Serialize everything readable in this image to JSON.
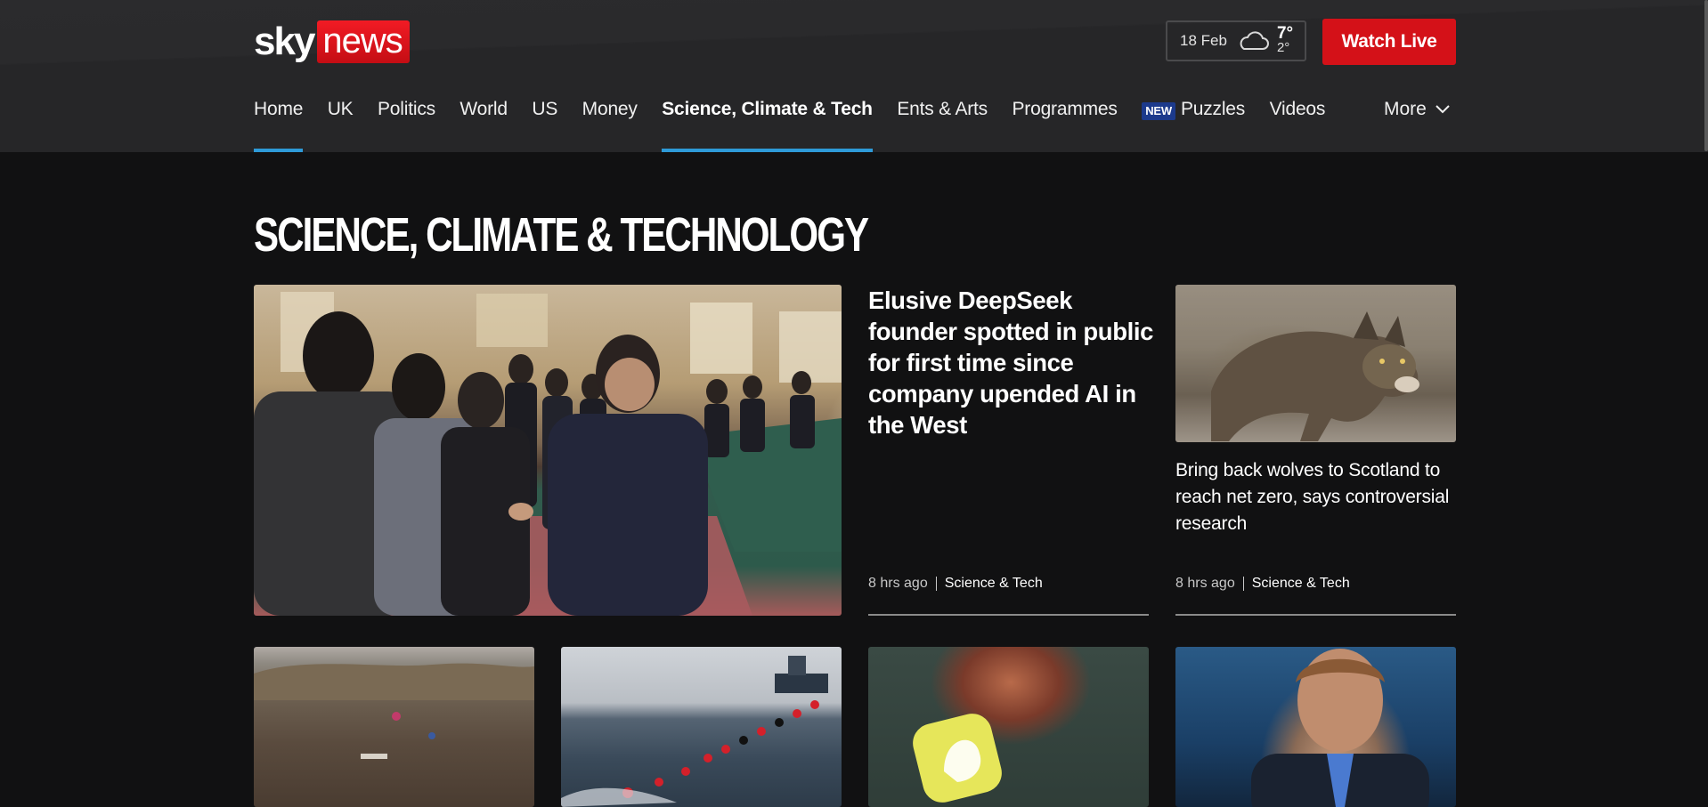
{
  "header": {
    "logo": {
      "sky": "sky",
      "news": "news"
    },
    "weather": {
      "date": "18 Feb",
      "icon": "cloud-icon",
      "high": "7°",
      "low": "2°"
    },
    "watch_live_label": "Watch Live",
    "nav": {
      "items": [
        {
          "label": "Home",
          "active": true
        },
        {
          "label": "UK"
        },
        {
          "label": "Politics"
        },
        {
          "label": "World"
        },
        {
          "label": "US"
        },
        {
          "label": "Money"
        },
        {
          "label": "Science, Climate & Tech",
          "active": true,
          "bold": true
        },
        {
          "label": "Ents & Arts"
        },
        {
          "label": "Programmes"
        },
        {
          "label": "Puzzles",
          "badge": "NEW"
        },
        {
          "label": "Videos"
        }
      ],
      "more_label": "More",
      "active_color": "#2e9ad8"
    }
  },
  "main": {
    "section_title": "SCIENCE, CLIMATE & TECHNOLOGY",
    "lead_story": {
      "headline": "Elusive DeepSeek founder spotted in public for first time since company upended AI in the West",
      "time": "8 hrs ago",
      "category": "Science & Tech"
    },
    "side_story": {
      "headline": "Bring back wolves to Scotland to reach net zero, says controversial research",
      "time": "8 hrs ago",
      "category": "Science & Tech"
    }
  },
  "colors": {
    "brand_red": "#d41118",
    "background": "#111112",
    "header_bg": "#262628"
  }
}
